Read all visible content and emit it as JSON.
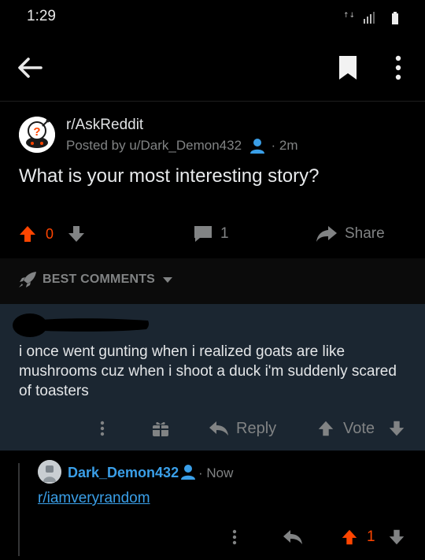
{
  "status_bar": {
    "time": "1:29"
  },
  "post": {
    "subreddit": "r/AskReddit",
    "meta_prefix": "Posted by",
    "author": "u/Dark_Demon432",
    "age": "2m",
    "title": "What is your most interesting story?",
    "score": "0",
    "comment_count": "1",
    "share_label": "Share"
  },
  "sort": {
    "label": "BEST COMMENTS"
  },
  "comment": {
    "body": "i once went gunting when i realized goats are like mushrooms cuz when i shoot a duck i'm suddenly scared of toasters",
    "reply_label": "Reply",
    "vote_label": "Vote"
  },
  "reply": {
    "author": "Dark_Demon432",
    "age": "Now",
    "link": "r/iamveryrandom",
    "score": "1"
  },
  "colors": {
    "background": "#000000",
    "comment_bg": "#1b2631",
    "upvote": "#ff4500",
    "link": "#3a9fe8",
    "muted": "#818384"
  },
  "icons": [
    "back-arrow-icon",
    "bookmark-icon",
    "more-vertical-icon",
    "subreddit-avatar-icon",
    "moderator-icon",
    "upvote-icon",
    "downvote-icon",
    "comment-icon",
    "share-icon",
    "rocket-icon",
    "chevron-down-icon",
    "gift-icon",
    "reply-icon"
  ]
}
